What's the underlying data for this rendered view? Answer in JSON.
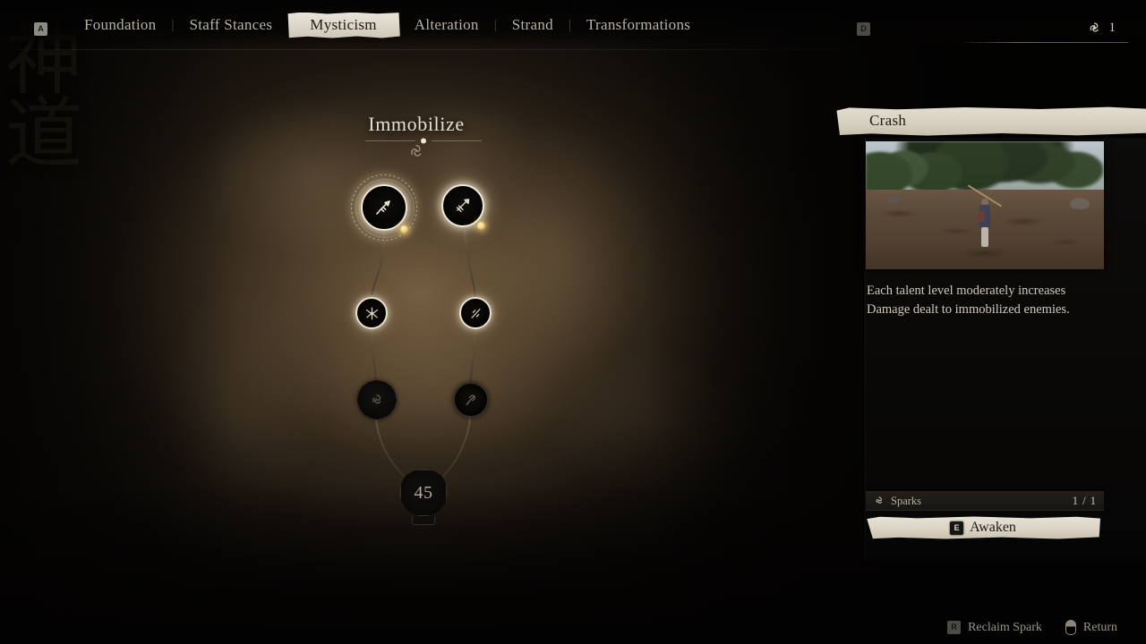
{
  "topnav": {
    "left_key": "A",
    "right_key": "D",
    "tabs": [
      {
        "label": "Foundation",
        "active": false
      },
      {
        "label": "Staff Stances",
        "active": false
      },
      {
        "label": "Mysticism",
        "active": true
      },
      {
        "label": "Alteration",
        "active": false
      },
      {
        "label": "Strand",
        "active": false
      },
      {
        "label": "Transformations",
        "active": false
      }
    ],
    "separator": "|",
    "spark_icon": "spark-swirl-icon",
    "spark_count": "1"
  },
  "tree": {
    "title": "Immobilize",
    "sigil_icon": "swirl-sigil-icon",
    "gate": {
      "level_requirement": "45"
    },
    "nodes": [
      {
        "id": "n1",
        "name": "crash-node",
        "state": "awakened",
        "selected": true,
        "icon": "fist-strike-icon"
      },
      {
        "id": "n2",
        "name": "pin-node",
        "state": "awakened",
        "selected": false,
        "icon": "pinned-blade-icon"
      },
      {
        "id": "n3",
        "name": "shatter-node",
        "state": "awakened",
        "selected": false,
        "icon": "burst-icon"
      },
      {
        "id": "n4",
        "name": "pierce-node",
        "state": "awakened",
        "selected": false,
        "icon": "slash-icon"
      },
      {
        "id": "n5",
        "name": "locked-spiral-node",
        "state": "locked",
        "selected": false,
        "icon": "spiral-icon"
      },
      {
        "id": "n6",
        "name": "locked-feather-node",
        "state": "locked",
        "selected": false,
        "icon": "feather-slash-icon"
      }
    ]
  },
  "panel": {
    "title": "Crash",
    "media_alt": "talent-preview-video",
    "description": "Each talent level moderately increases Damage dealt to immobilized enemies.",
    "sparks": {
      "icon": "spark-swirl-icon",
      "label": "Sparks",
      "count": "1 / 1"
    },
    "action": {
      "key": "E",
      "label": "Awaken"
    }
  },
  "hints": [
    {
      "key": "R",
      "label": "Reclaim Spark",
      "icon": "key-badge"
    },
    {
      "key": "",
      "label": "Return",
      "icon": "mouse-icon"
    }
  ],
  "background": {
    "kanji": [
      "神",
      "道"
    ]
  },
  "colors": {
    "parchment": "#ddd7c8",
    "node_glow": "#f0e7d0",
    "spark_amber": "#f0cf7a",
    "text_light": "#cfc8ba",
    "backdrop": "#0a0806"
  }
}
